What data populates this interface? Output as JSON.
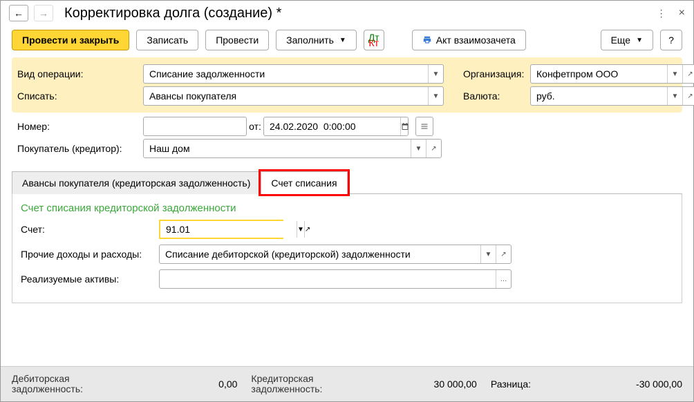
{
  "title": "Корректировка долга (создание) *",
  "toolbar": {
    "post_close": "Провести и закрыть",
    "save": "Записать",
    "post": "Провести",
    "fill": "Заполнить",
    "act": "Акт взаимозачета",
    "more": "Еще",
    "help": "?"
  },
  "fields": {
    "op_type_label": "Вид операции:",
    "op_type_value": "Списание задолженности",
    "writeoff_label": "Списать:",
    "writeoff_value": "Авансы покупателя",
    "org_label": "Организация:",
    "org_value": "Конфетпром ООО",
    "currency_label": "Валюта:",
    "currency_value": "руб.",
    "number_label": "Номер:",
    "number_value": "",
    "date_label": "от:",
    "date_value": "24.02.2020  0:00:00",
    "buyer_label": "Покупатель (кредитор):",
    "buyer_value": "Наш дом"
  },
  "tabs": {
    "t1": "Авансы покупателя (кредиторская задолженность)",
    "t2": "Счет списания"
  },
  "tab2": {
    "section": "Счет списания кредиторской задолженности",
    "account_label": "Счет:",
    "account_value": "91.01",
    "other_label": "Прочие доходы и расходы:",
    "other_value": "Списание дебиторской (кредиторской) задолженности",
    "assets_label": "Реализуемые активы:",
    "assets_value": ""
  },
  "footer": {
    "deb_label1": "Дебиторская",
    "deb_label2": "задолженность:",
    "deb_value": "0,00",
    "cred_label1": "Кредиторская",
    "cred_label2": "задолженность:",
    "cred_value": "30 000,00",
    "diff_label": "Разница:",
    "diff_value": "-30 000,00"
  }
}
